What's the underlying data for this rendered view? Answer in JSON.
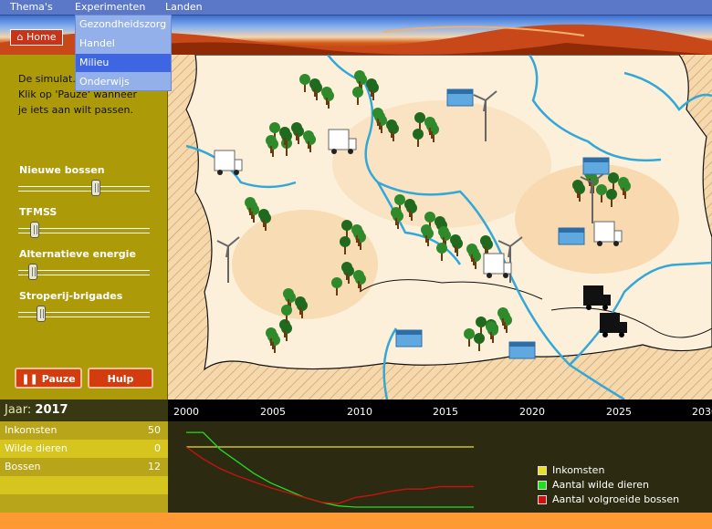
{
  "menu": {
    "items": [
      "Thema's",
      "Experimenten",
      "Landen"
    ]
  },
  "dropdown": {
    "items": [
      "Gezondheidszorg",
      "Handel",
      "Milieu",
      "Onderwijs"
    ],
    "selected": "Milieu"
  },
  "home": {
    "label": "Home",
    "icon": "house-icon"
  },
  "sidebar": {
    "intro_lines": [
      "De simulat...",
      "Klik op 'Pauze' wanneer",
      "je iets aan wilt passen."
    ],
    "sliders": [
      {
        "label": "Nieuwe bossen",
        "value": 0.6
      },
      {
        "label": "TFMSS",
        "value": 0.1
      },
      {
        "label": "Alternatieve energie",
        "value": 0.08
      },
      {
        "label": "Stroperij-brigades",
        "value": 0.15
      }
    ],
    "pause_label": "Pauze",
    "help_label": "Hulp"
  },
  "stats": {
    "year_label": "Jaar:",
    "year_value": "2017",
    "rows": [
      {
        "label": "Inkomsten",
        "value": "50"
      },
      {
        "label": "Wilde dieren",
        "value": "0"
      },
      {
        "label": "Bossen",
        "value": "12"
      }
    ]
  },
  "timeline": {
    "ticks": [
      "2000",
      "2005",
      "2010",
      "2015",
      "2020",
      "2025",
      "2030"
    ]
  },
  "chart_data": {
    "type": "line",
    "x": [
      2000,
      2001,
      2002,
      2003,
      2004,
      2005,
      2006,
      2007,
      2008,
      2009,
      2010,
      2011,
      2012,
      2013,
      2014,
      2015,
      2016,
      2017
    ],
    "series": [
      {
        "name": "Inkomsten",
        "color": "#e8e028",
        "values": [
          50,
          50,
          50,
          50,
          50,
          50,
          50,
          50,
          50,
          50,
          50,
          50,
          50,
          50,
          50,
          50,
          50,
          50
        ]
      },
      {
        "name": "Aantal wilde dieren",
        "color": "#22dd22",
        "values": [
          62,
          62,
          48,
          38,
          28,
          20,
          14,
          8,
          4,
          1,
          0,
          0,
          0,
          0,
          0,
          0,
          0,
          0
        ]
      },
      {
        "name": "Aantal volgroeide bossen",
        "color": "#cc1111",
        "values": [
          50,
          40,
          32,
          26,
          21,
          16,
          12,
          8,
          4,
          3,
          8,
          10,
          13,
          15,
          15,
          17,
          17,
          17
        ]
      }
    ],
    "ylim": [
      0,
      100
    ]
  },
  "colors": {
    "accent": "#5b78c8",
    "sidebar": "#ad9a08",
    "button": "#d33c0f",
    "river": "#33a8d8"
  }
}
